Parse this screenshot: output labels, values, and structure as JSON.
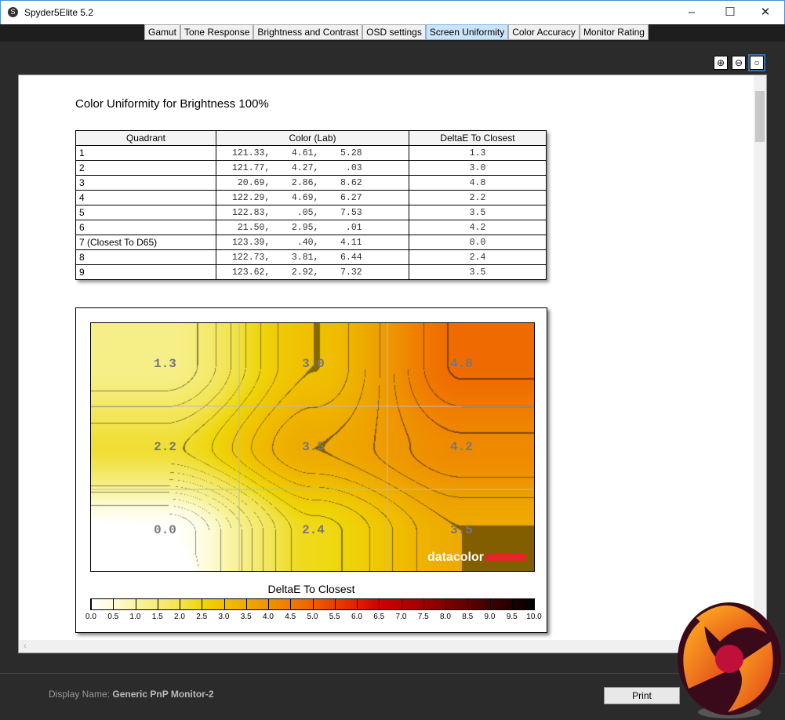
{
  "window": {
    "title": "Spyder5Elite 5.2",
    "minimize": "–",
    "maximize": "☐",
    "close": "✕"
  },
  "tabs": [
    {
      "label": "Gamut"
    },
    {
      "label": "Tone Response"
    },
    {
      "label": "Brightness and Contrast"
    },
    {
      "label": "OSD settings"
    },
    {
      "label": "Screen Uniformity",
      "active": true
    },
    {
      "label": "Color Accuracy"
    },
    {
      "label": "Monitor Rating"
    }
  ],
  "zoom": {
    "in_icon": "zoom-in-icon",
    "out_icon": "zoom-out-icon",
    "fit_icon": "zoom-fit-icon"
  },
  "report": {
    "title": "Color Uniformity for Brightness 100%",
    "table": {
      "headers": [
        "Quadrant",
        "Color (Lab)",
        "DeltaE To Closest"
      ],
      "rows": [
        [
          "1",
          "121.33,    4.61,    5.28",
          "1.3"
        ],
        [
          "2",
          "121.77,    4.27,     .03",
          "3.0"
        ],
        [
          "3",
          " 20.69,    2.86,    8.62",
          "4.8"
        ],
        [
          "4",
          "122.29,    4.69,    6.27",
          "2.2"
        ],
        [
          "5",
          "122.83,     .05,    7.53",
          "3.5"
        ],
        [
          "6",
          " 21.50,    2.95,     .01",
          "4.2"
        ],
        [
          "7 (Closest To D65)",
          "123.39,     .40,    4.11",
          "0.0"
        ],
        [
          "8",
          "122.73,    3.81,    6.44",
          "2.4"
        ],
        [
          "9",
          "123.62,    2.92,    7.32",
          "3.5"
        ]
      ]
    }
  },
  "chart_data": {
    "type": "heatmap",
    "grid": [
      [
        "1.3",
        "3.0",
        "4.8"
      ],
      [
        "2.2",
        "3.5",
        "4.2"
      ],
      [
        "0.0",
        "2.4",
        "3.5"
      ]
    ],
    "colorbar_title": "DeltaE To Closest",
    "colorbar_ticks": [
      "0.0",
      "0.5",
      "1.0",
      "1.5",
      "2.0",
      "2.5",
      "3.0",
      "3.5",
      "4.0",
      "4.5",
      "5.0",
      "5.5",
      "6.0",
      "6.5",
      "7.0",
      "7.5",
      "8.0",
      "8.5",
      "9.0",
      "9.5",
      "10.0"
    ],
    "range": [
      0,
      10
    ],
    "watermark": "datacolor"
  },
  "footer": {
    "display_label": "Display Name:",
    "display_value": "Generic PnP Monitor-2",
    "print": "Print"
  },
  "colors": {
    "accent": "#cce4f7",
    "brand_red": "#e3262a"
  }
}
